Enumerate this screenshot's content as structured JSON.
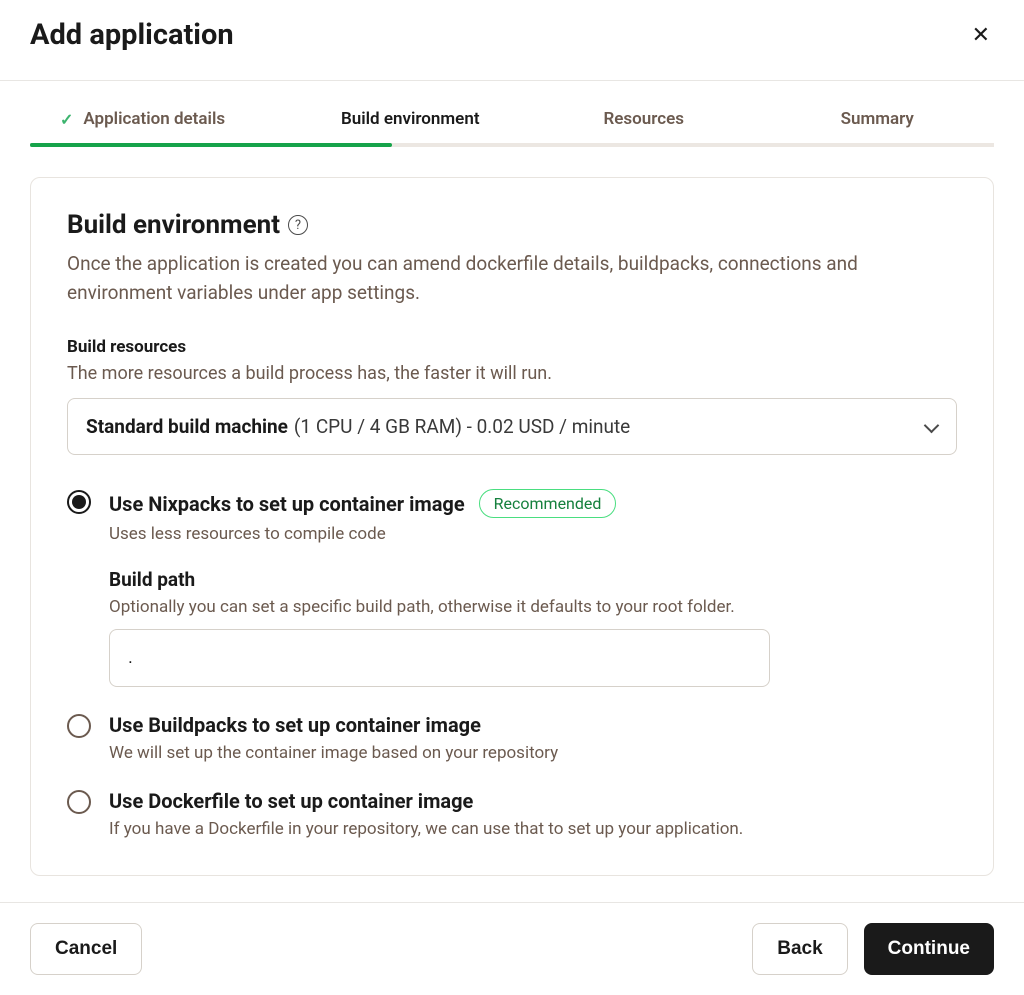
{
  "header": {
    "title": "Add application"
  },
  "stepper": {
    "items": [
      {
        "label": "Application details",
        "completed": true
      },
      {
        "label": "Build environment",
        "active": true
      },
      {
        "label": "Resources"
      },
      {
        "label": "Summary"
      }
    ]
  },
  "build_env": {
    "title": "Build environment",
    "description": "Once the application is created you can amend dockerfile details, buildpacks, connections and environment variables under app settings.",
    "resources_label": "Build resources",
    "resources_desc": "The more resources a build process has, the faster it will run.",
    "machine_select": {
      "name": "Standard build machine",
      "detail": "(1 CPU / 4 GB RAM) - 0.02 USD / minute"
    },
    "options": [
      {
        "title": "Use Nixpacks to set up container image",
        "desc": "Uses less resources to compile code",
        "badge": "Recommended",
        "selected": true,
        "build_path": {
          "label": "Build path",
          "desc": "Optionally you can set a specific build path, otherwise it defaults to your root folder.",
          "value": "."
        }
      },
      {
        "title": "Use Buildpacks to set up container image",
        "desc": "We will set up the container image based on your repository"
      },
      {
        "title": "Use Dockerfile to set up container image",
        "desc": "If you have a Dockerfile in your repository, we can use that to set up your application."
      }
    ]
  },
  "footer": {
    "cancel": "Cancel",
    "back": "Back",
    "continue": "Continue"
  }
}
